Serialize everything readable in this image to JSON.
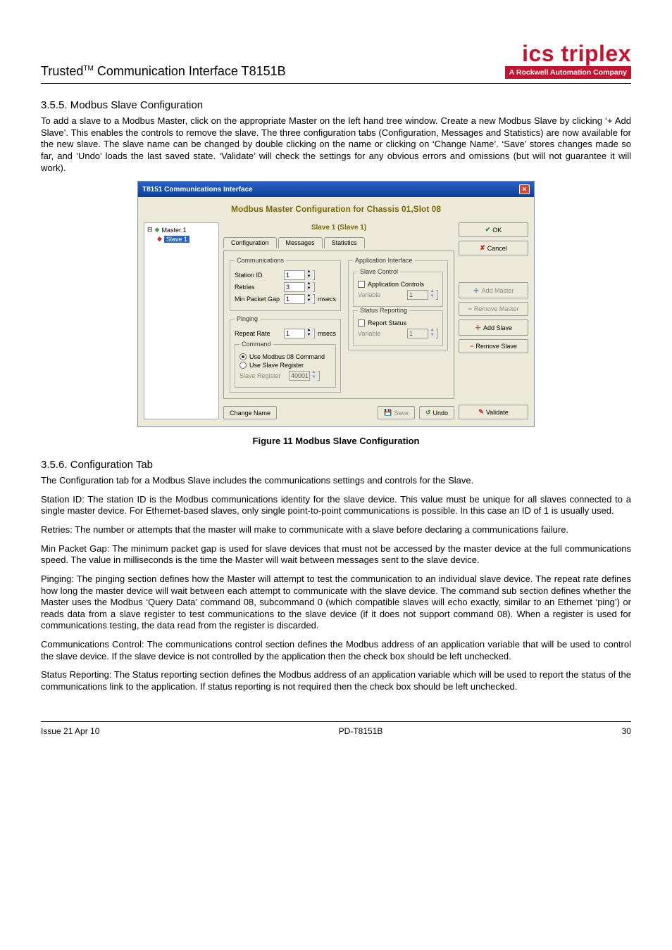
{
  "header": {
    "product_line": "Trusted",
    "tm": "TM",
    "product_title": " Communication Interface T8151B",
    "logo_main": "ics triplex",
    "logo_sub": "A Rockwell Automation Company"
  },
  "sections": {
    "s355_num": "3.5.5.",
    "s355_title": "  Modbus Slave Configuration",
    "s355_para": "To add a slave to a Modbus Master, click on the appropriate Master on the left hand tree window. Create a new Modbus Slave by clicking ‘+ Add Slave’. This enables the controls to remove the slave. The three configuration tabs (Configuration, Messages and Statistics) are now available for the new slave. The slave name can be changed by double clicking on the name or clicking on ‘Change Name’. ‘Save’ stores changes made so far, and ‘Undo’ loads the last saved state. ‘Validate’ will check the settings for any obvious errors and omissions (but will not guarantee it will work).",
    "fig_caption": "Figure 11 Modbus Slave Configuration",
    "s356_num": "3.5.6.",
    "s356_title": "  Configuration Tab",
    "s356_p1": "The Configuration tab for a Modbus Slave includes the communications settings and controls for the Slave.",
    "s356_p2": "Station ID: The station ID is the Modbus communications identity for the slave device. This value must be unique for all slaves connected to a single master device. For Ethernet-based slaves, only single point-to-point communications is possible. In this case an ID of 1 is usually used.",
    "s356_p3": "Retries: The number or attempts that the master will make to communicate with a slave before declaring a communications failure.",
    "s356_p4": "Min Packet Gap: The minimum packet gap is used for slave devices that must not be accessed by the master device at the full communications speed.  The value in milliseconds is the time the Master will wait between messages sent to the slave device.",
    "s356_p5": "Pinging: The pinging section defines how the Master will attempt to test the communication to an individual slave device.  The repeat rate defines how long the master device will wait between each attempt to communicate with the slave device.  The command sub section defines whether the Master uses the Modbus ‘Query Data’ command 08, subcommand 0 (which compatible slaves will echo exactly, similar to an Ethernet ‘ping’) or reads data from a slave register to test communications to the slave device (if it does not support command 08).  When a register is used for communications testing, the data read from the register is discarded.",
    "s356_p6": "Communications Control: The communications control section defines the Modbus address of an application variable that will be used to control the slave device.  If the slave device is not controlled by the application then the check box should be left unchecked.",
    "s356_p7": "Status Reporting: The Status reporting section defines the Modbus address of an application variable which will be used to report the status of the communications link to the application.  If status reporting is not required then the check box should be left unchecked."
  },
  "screenshot": {
    "window_title": "T8151 Communications Interface",
    "cfg_header": "Modbus Master Configuration for Chassis 01,Slot 08",
    "tree": {
      "master": "Master 1",
      "slave": "Slave 1"
    },
    "center": {
      "slave_title": "Slave 1 (Slave 1)",
      "tabs": {
        "t1": "Configuration",
        "t2": "Messages",
        "t3": "Statistics"
      },
      "groups": {
        "comms": {
          "legend": "Communications",
          "station_id_label": "Station ID",
          "station_id_value": "1",
          "retries_label": "Retries",
          "retries_value": "3",
          "gap_label": "Min Packet Gap",
          "gap_value": "1",
          "gap_unit": "msecs"
        },
        "pinging": {
          "legend": "Pinging",
          "rate_label": "Repeat Rate",
          "rate_value": "1",
          "rate_unit": "msecs"
        },
        "command": {
          "legend": "Command",
          "r1": "Use Modbus 08 Command",
          "r2": "Use Slave Register",
          "reg_label": "Slave Register",
          "reg_value": "40001"
        },
        "appif": {
          "legend": "Application Interface",
          "slave_ctrl_legend": "Slave Control",
          "app_ctrl_label": "Application Controls",
          "var_label": "Variable",
          "var_value": "1",
          "status_legend": "Status Reporting",
          "report_label": "Report Status",
          "status_var_label": "Variable",
          "status_var_value": "1"
        }
      },
      "bottom_buttons": {
        "change_name": "Change Name",
        "save": "Save",
        "undo": "Undo"
      }
    },
    "right": {
      "ok": "OK",
      "cancel": "Cancel",
      "add_master": "Add Master",
      "remove_master": "Remove Master",
      "add_slave": "Add Slave",
      "remove_slave": "Remove Slave",
      "validate": "Validate"
    }
  },
  "footer": {
    "left": "Issue 21 Apr 10",
    "center": "PD-T8151B",
    "right": "30"
  }
}
